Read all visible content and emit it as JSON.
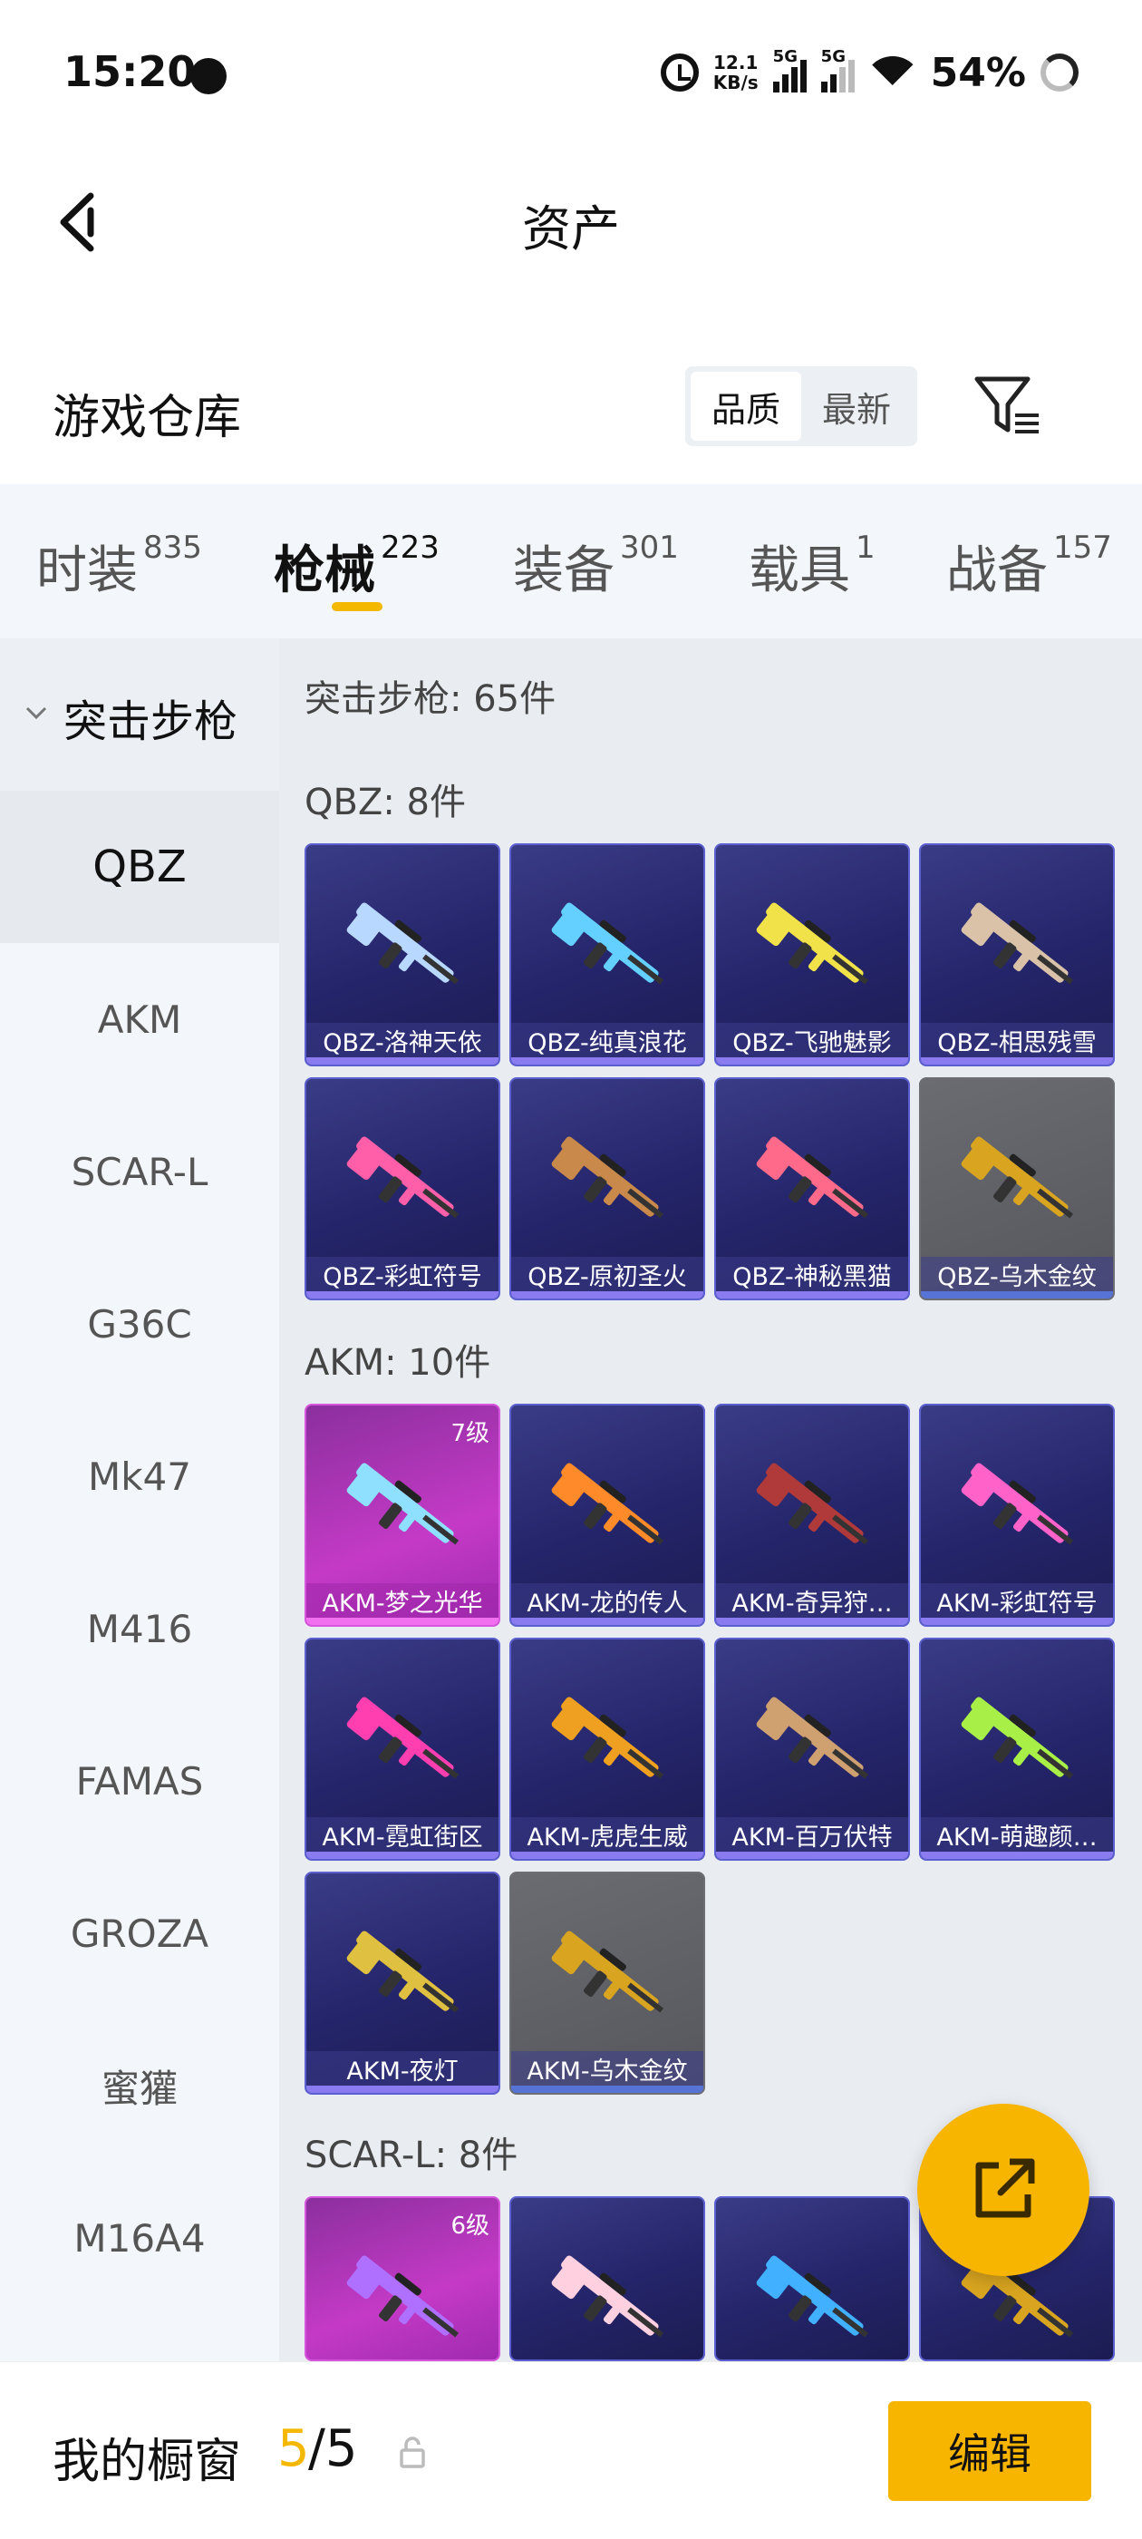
{
  "status_bar": {
    "time": "15:20",
    "speed_value": "12.1",
    "speed_unit": "KB/s",
    "signal1": "5G",
    "signal2": "5G",
    "battery": "54%"
  },
  "header": {
    "title": "资产"
  },
  "warehouse": {
    "title": "游戏仓库",
    "sort_options": [
      {
        "label": "品质",
        "active": true
      },
      {
        "label": "最新",
        "active": false
      }
    ]
  },
  "tabs": [
    {
      "label": "时装",
      "count": "835",
      "active": false
    },
    {
      "label": "枪械",
      "count": "223",
      "active": true
    },
    {
      "label": "装备",
      "count": "301",
      "active": false
    },
    {
      "label": "载具",
      "count": "1",
      "active": false
    },
    {
      "label": "战备",
      "count": "157",
      "active": false
    }
  ],
  "sidebar": {
    "group_label": "突击步枪",
    "items": [
      "QBZ",
      "AKM",
      "SCAR-L",
      "G36C",
      "Mk47",
      "M416",
      "FAMAS",
      "GROZA",
      "蜜獾",
      "M16A4"
    ],
    "active_index": 0
  },
  "content": {
    "category_summary": "突击步枪: 65件",
    "sections": [
      {
        "title": "QBZ: 8件",
        "items": [
          {
            "name": "QBZ-洛神天依",
            "style": "purple",
            "gun_color": "#b8d8ff"
          },
          {
            "name": "QBZ-纯真浪花",
            "style": "purple",
            "gun_color": "#63d0ff"
          },
          {
            "name": "QBZ-飞驰魅影",
            "style": "purple",
            "gun_color": "#f2e24a"
          },
          {
            "name": "QBZ-相思残雪",
            "style": "purple",
            "gun_color": "#d9c2a8"
          },
          {
            "name": "QBZ-彩虹符号",
            "style": "purple",
            "gun_color": "#ff5fa8"
          },
          {
            "name": "QBZ-原初圣火",
            "style": "purple",
            "gun_color": "#c8894a"
          },
          {
            "name": "QBZ-神秘黑猫",
            "style": "purple",
            "gun_color": "#ff6a8a"
          },
          {
            "name": "QBZ-乌木金纹",
            "style": "gray",
            "gun_color": "#d9a520"
          }
        ]
      },
      {
        "title": "AKM: 10件",
        "items": [
          {
            "name": "AKM-梦之光华",
            "style": "pink",
            "gun_color": "#8fe0ff",
            "level": "7级"
          },
          {
            "name": "AKM-龙的传人",
            "style": "purple",
            "gun_color": "#ff8a2a"
          },
          {
            "name": "AKM-奇异狩…",
            "style": "purple",
            "gun_color": "#b03a3a"
          },
          {
            "name": "AKM-彩虹符号",
            "style": "purple",
            "gun_color": "#ff62c8"
          },
          {
            "name": "AKM-霓虹街区",
            "style": "purple",
            "gun_color": "#ff3fb0"
          },
          {
            "name": "AKM-虎虎生威",
            "style": "purple",
            "gun_color": "#f0a020"
          },
          {
            "name": "AKM-百万伏特",
            "style": "purple",
            "gun_color": "#cfa070"
          },
          {
            "name": "AKM-萌趣颜…",
            "style": "purple",
            "gun_color": "#a8f048"
          },
          {
            "name": "AKM-夜灯",
            "style": "purple",
            "gun_color": "#e0c040"
          },
          {
            "name": "AKM-乌木金纹",
            "style": "gray",
            "gun_color": "#d9a520"
          }
        ]
      },
      {
        "title": "SCAR-L: 8件",
        "items": [
          {
            "name": "",
            "style": "pink",
            "gun_color": "#b070ff",
            "level": "6级"
          },
          {
            "name": "",
            "style": "purple",
            "gun_color": "#ffd0e0"
          },
          {
            "name": "",
            "style": "purple",
            "gun_color": "#40b0ff"
          },
          {
            "name": "",
            "style": "purple",
            "gun_color": "#d9a520"
          }
        ]
      }
    ]
  },
  "bottom_bar": {
    "label": "我的橱窗",
    "current": "5",
    "total": "/5",
    "edit_label": "编辑"
  },
  "colors": {
    "accent": "#f8b500",
    "card_purple": "#2a2a6e",
    "card_pink": "#c43ac6"
  },
  "icons": [
    "back-icon",
    "filter-icon",
    "chevron-down-icon",
    "share-icon",
    "lock-icon",
    "rifle-icon"
  ]
}
